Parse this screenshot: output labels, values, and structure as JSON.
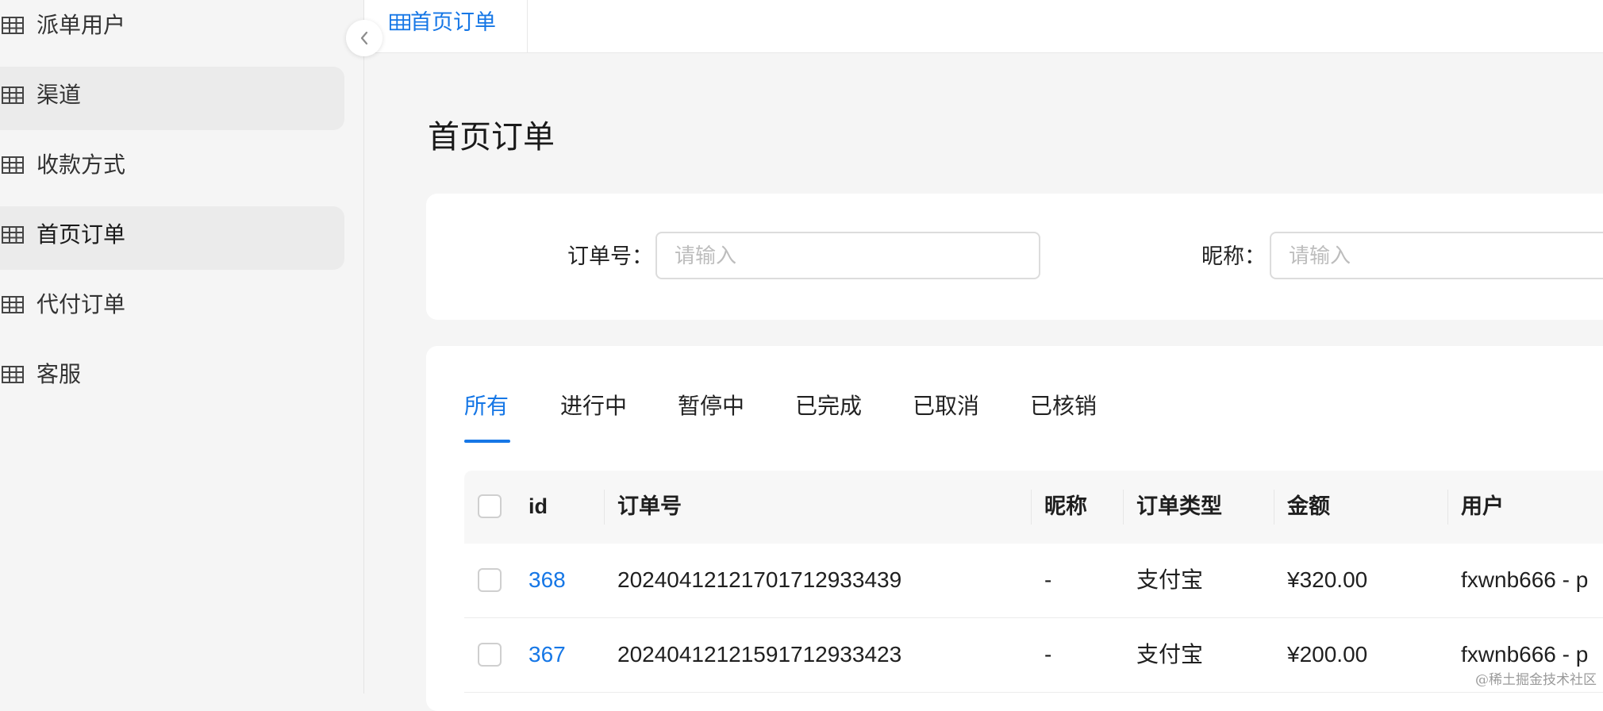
{
  "sidebar": {
    "items": [
      {
        "label": "派单用户",
        "icon": "table-grid-icon"
      },
      {
        "label": "渠道",
        "icon": "table-grid-icon"
      },
      {
        "label": "收款方式",
        "icon": "table-grid-icon"
      },
      {
        "label": "首页订单",
        "icon": "table-grid-icon",
        "active": true
      },
      {
        "label": "代付订单",
        "icon": "table-grid-icon"
      },
      {
        "label": "客服",
        "icon": "table-grid-icon"
      }
    ],
    "collapse_icon": "chevron-left-icon"
  },
  "tabbar": {
    "tabs": [
      {
        "label": "首页订单",
        "icon": "table-grid-icon",
        "active": true
      }
    ]
  },
  "page": {
    "title": "首页订单"
  },
  "filters": {
    "order_no": {
      "label": "订单号：",
      "placeholder": "请输入"
    },
    "nickname": {
      "label": "昵称：",
      "placeholder": "请输入"
    }
  },
  "status_tabs": [
    "所有",
    "进行中",
    "暂停中",
    "已完成",
    "已取消",
    "已核销"
  ],
  "table": {
    "columns": [
      "id",
      "订单号",
      "昵称",
      "订单类型",
      "金额",
      "用户"
    ],
    "rows": [
      {
        "id": "368",
        "order_no": "20240412121701712933439",
        "nickname": "-",
        "type": "支付宝",
        "amount": "¥320.00",
        "user": "fxwnb666 - p"
      },
      {
        "id": "367",
        "order_no": "20240412121591712933423",
        "nickname": "-",
        "type": "支付宝",
        "amount": "¥200.00",
        "user": "fxwnb666 - p"
      }
    ]
  },
  "watermark": "@稀土掘金技术社区",
  "colors": {
    "accent": "#1677e6",
    "background": "#f5f5f5",
    "card": "#ffffff"
  }
}
